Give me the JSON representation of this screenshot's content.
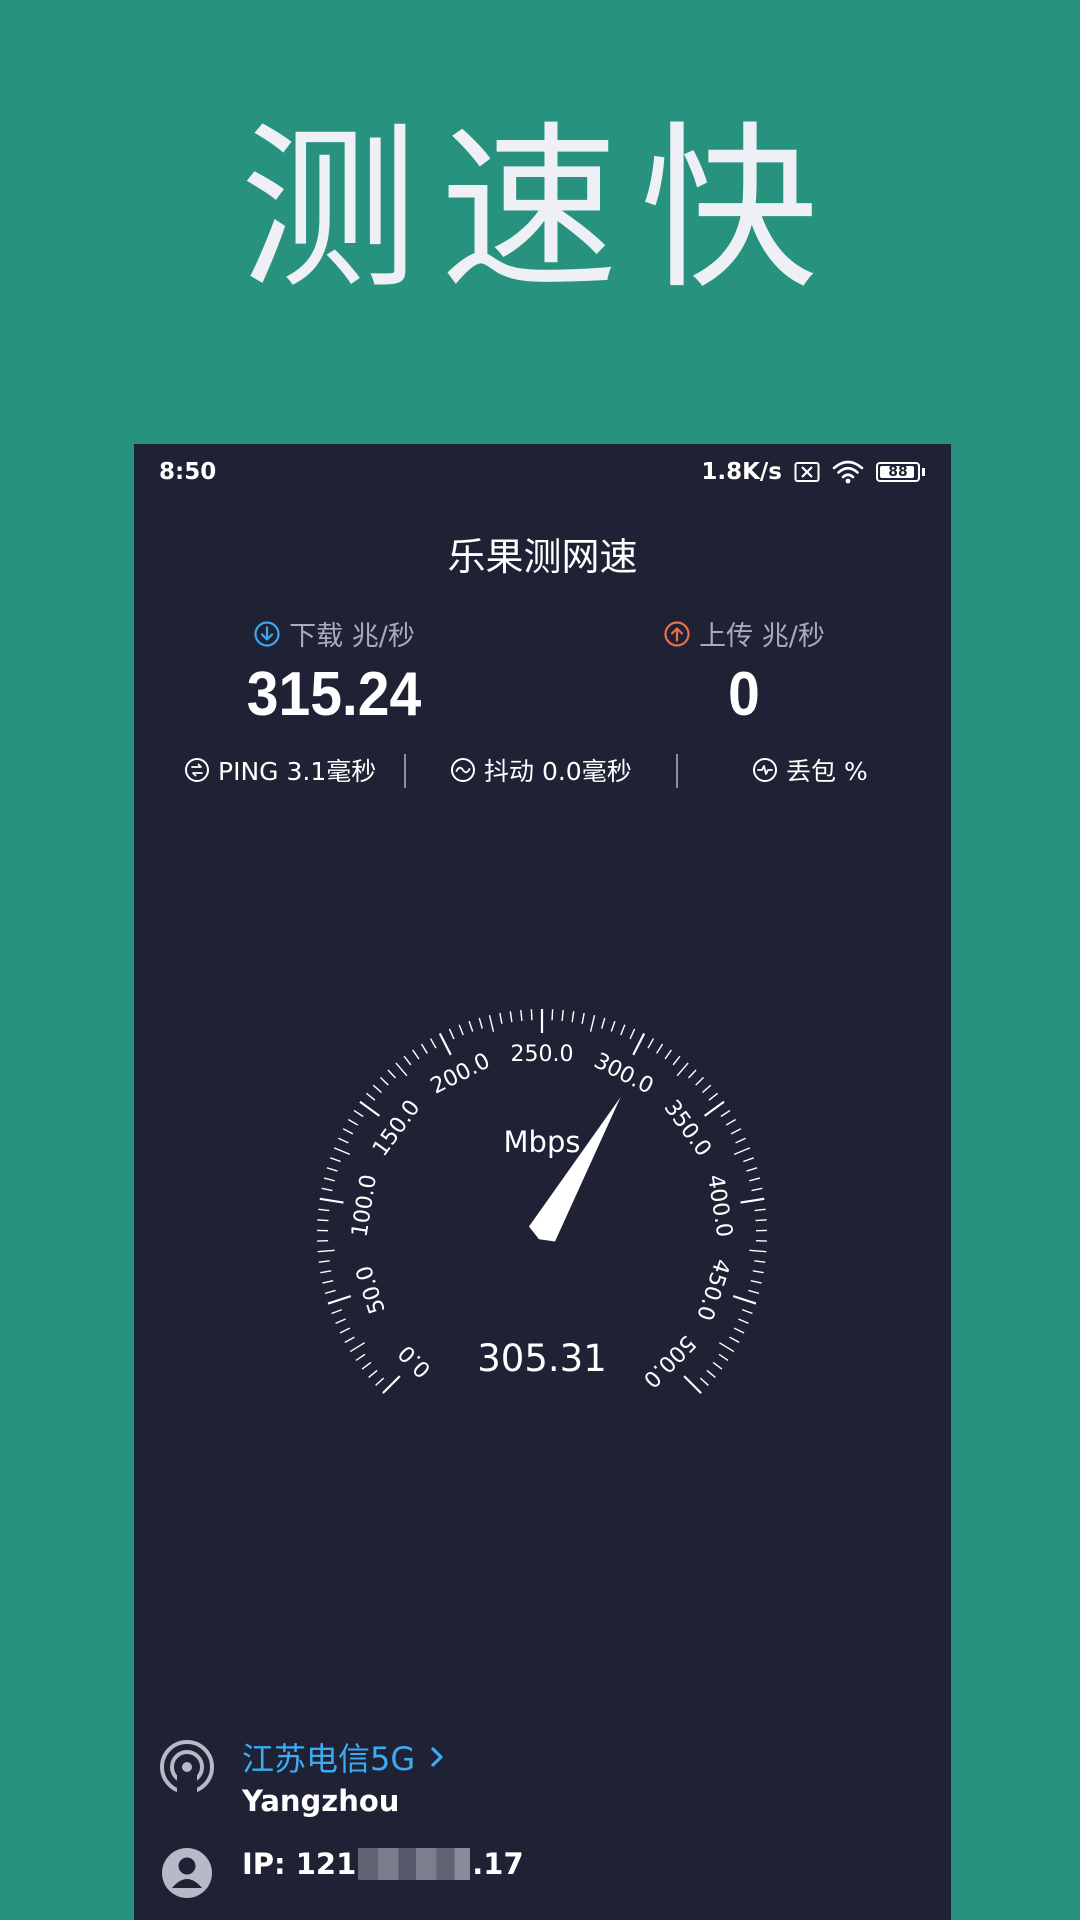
{
  "promo": {
    "title": "测速快"
  },
  "status_bar": {
    "time": "8:50",
    "net_speed": "1.8K/s",
    "battery": "88"
  },
  "app": {
    "title": "乐果测网速"
  },
  "download": {
    "label": "下载 兆/秒",
    "value": "315.24",
    "icon_color": "#3ea6ec"
  },
  "upload": {
    "label": "上传 兆/秒",
    "value": "0",
    "icon_color": "#e9704d"
  },
  "stats": {
    "ping": "PING 3.1毫秒",
    "jitter": "抖动 0.0毫秒",
    "loss": "丢包 %"
  },
  "gauge": {
    "unit": "Mbps",
    "reading": "305.31",
    "reading_value": 305.31,
    "min": 0,
    "max": 500,
    "tick_labels": [
      "0.0",
      "50.0",
      "100.0",
      "150.0",
      "200.0",
      "250.0",
      "300.0",
      "350.0",
      "400.0",
      "450.0",
      "500.0"
    ]
  },
  "network": {
    "carrier": "江苏电信5G",
    "city": "Yangzhou",
    "ip_prefix": "IP: 121",
    "ip_suffix": ".17"
  },
  "colors": {
    "background": "#27937f",
    "panel": "#1f2234",
    "accent_blue": "#3eaaf0"
  }
}
